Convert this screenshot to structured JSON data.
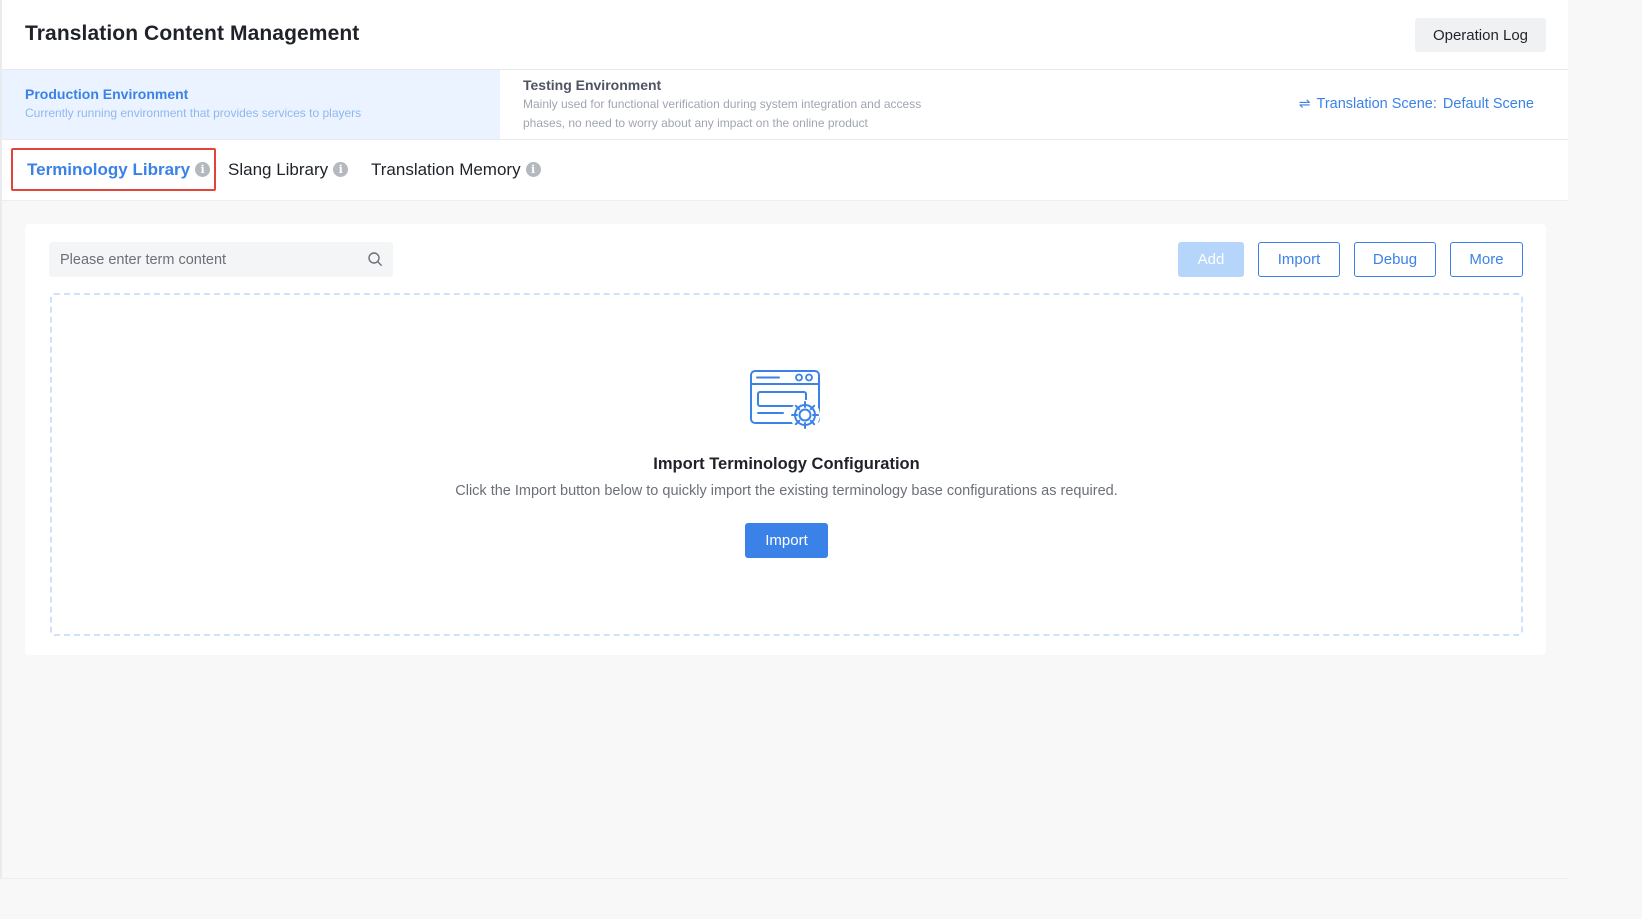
{
  "header": {
    "title": "Translation Content Management",
    "operation_log_label": "Operation Log"
  },
  "environments": [
    {
      "title": "Production Environment",
      "description": "Currently running environment that provides services to players",
      "selected": true
    },
    {
      "title": "Testing Environment",
      "description": "Mainly used for functional verification during system integration and access phases, no need to worry about any impact on the online product",
      "selected": false
    }
  ],
  "scene": {
    "label": "Translation Scene",
    "separator": ":",
    "value": "Default Scene",
    "icon": "swap-arrows-icon"
  },
  "tabs": [
    {
      "label": "Terminology Library",
      "active": true,
      "icon": "info-icon"
    },
    {
      "label": "Slang Library",
      "active": false,
      "icon": "info-icon"
    },
    {
      "label": "Translation Memory",
      "active": false,
      "icon": "info-icon"
    }
  ],
  "toolbar": {
    "search_placeholder": "Please enter term content",
    "search_value": "",
    "add_label": "Add",
    "import_label": "Import",
    "debug_label": "Debug",
    "more_label": "More"
  },
  "empty_state": {
    "icon": "configuration-settings-illustration",
    "title": "Import Terminology Configuration",
    "description": "Click the Import button below to quickly import the existing terminology base configurations as required.",
    "button_label": "Import"
  },
  "colors": {
    "primary": "#3b82e8",
    "primary_disabled": "#b6d5fb",
    "selected_env_bg": "#eaf3ff",
    "highlight_border": "#e0443a",
    "page_bg": "#f8f8f9"
  }
}
